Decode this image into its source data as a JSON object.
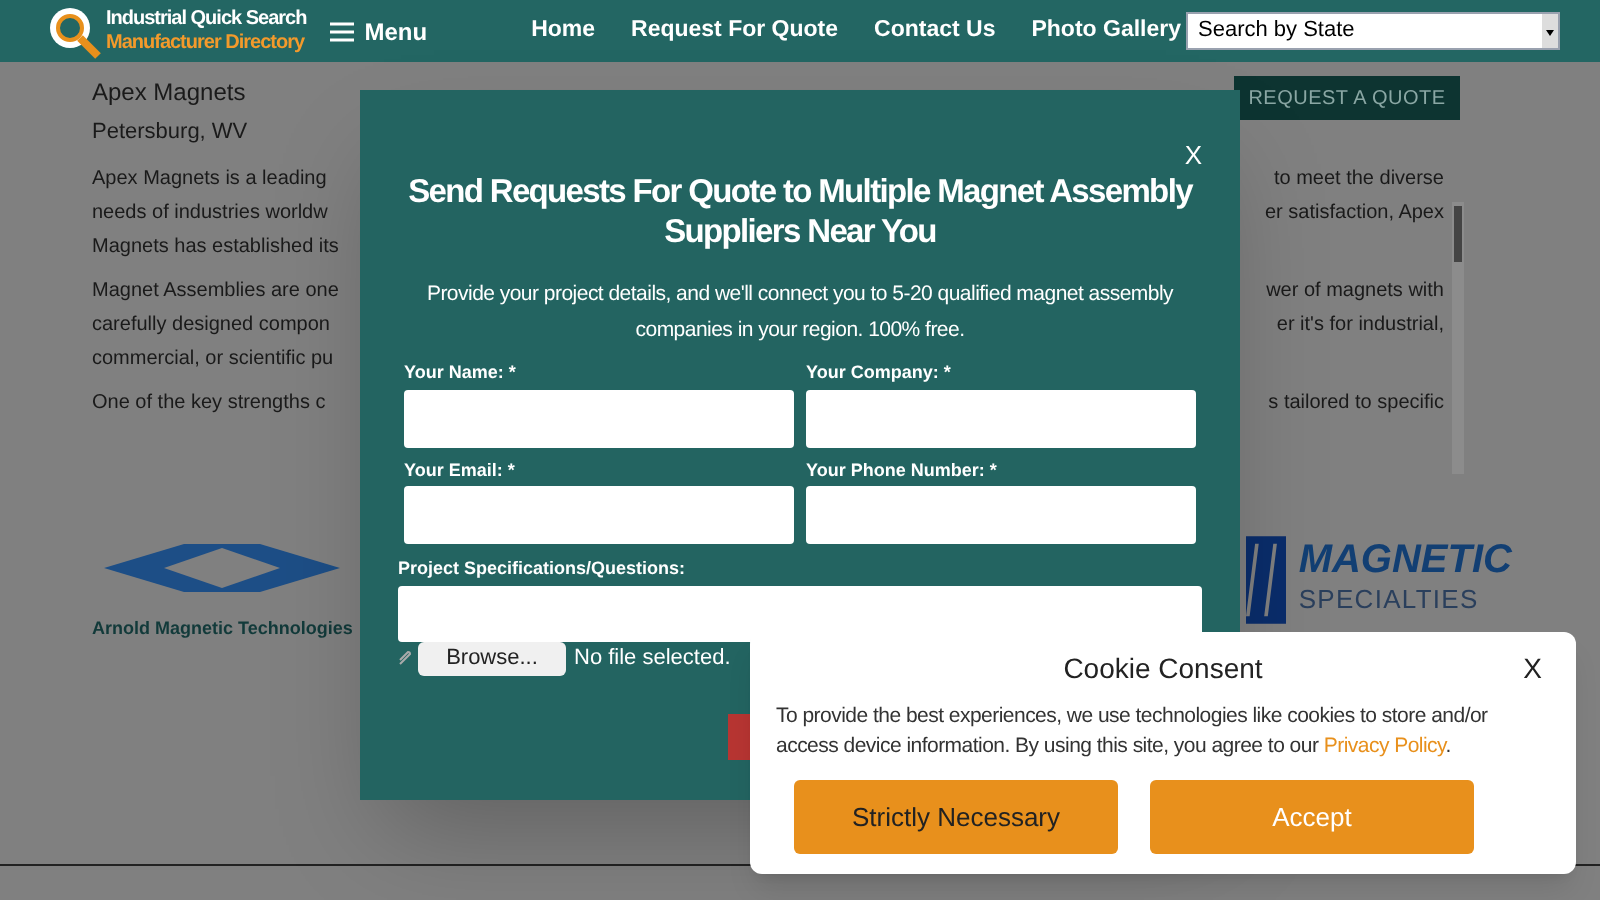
{
  "header": {
    "logo_line1": "Industrial Quick Search",
    "logo_line2": "Manufacturer Directory",
    "menu": "Menu",
    "nav": [
      "Home",
      "Request For Quote",
      "Contact Us",
      "Photo Gallery"
    ],
    "state_select": "Search by State"
  },
  "company": {
    "name": "Apex Magnets",
    "location": "Petersburg, WV",
    "quote_button": "REQUEST A QUOTE",
    "paragraphs": [
      [
        {
          "left": "Apex Magnets is a leading",
          "right": "to meet the diverse"
        },
        {
          "left": "needs of industries worldw",
          "right": "er satisfaction, Apex"
        },
        {
          "left": "Magnets has established its"
        }
      ],
      [
        {
          "left": "Magnet Assemblies are one",
          "right": "wer of magnets with"
        },
        {
          "left": "carefully designed compon",
          "right": "er it's for industrial,"
        },
        {
          "left": "commercial, or scientific pu"
        }
      ],
      [
        {
          "left": "One of the key strengths c",
          "right": "s tailored to specific"
        }
      ]
    ]
  },
  "logos": {
    "left": "Arnold Magnetic Technologies",
    "right_line1": "MAGNETIC",
    "right_line2": "SPECIALTIES"
  },
  "modal": {
    "close": "X",
    "title": "Send Requests For Quote to Multiple Magnet Assembly Suppliers Near You",
    "intro": "Provide your project details, and we'll connect you to 5-20 qualified magnet assembly companies in your region. 100% free.",
    "fields": [
      {
        "label": "Your Name: *"
      },
      {
        "label": "Your Company: *"
      },
      {
        "label": "Your Email: *"
      },
      {
        "label": "Your Phone Number: *"
      }
    ],
    "specs_label": "Project Specifications/Questions:",
    "browse": "Browse...",
    "file_status": "No file selected."
  },
  "cookie": {
    "title": "Cookie Consent",
    "close": "X",
    "text": "To provide the best experiences, we use technologies like cookies to store and/or access device information. By using this site, you agree to our",
    "link": "Privacy Policy",
    "link_suffix": ".",
    "buttons": [
      {
        "label": "Strictly Necessary",
        "kind": "secondary"
      },
      {
        "label": "Accept",
        "kind": "primary"
      }
    ]
  }
}
